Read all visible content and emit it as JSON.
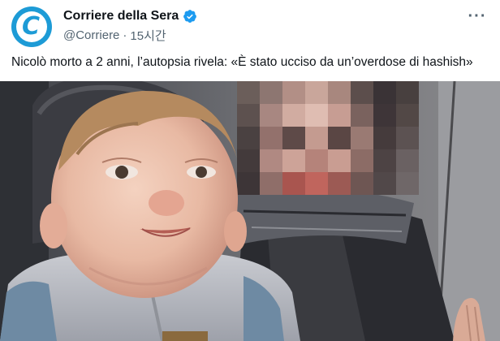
{
  "account": {
    "display_name": "Corriere della Sera",
    "handle": "@Corriere",
    "separator": "·",
    "timestamp": "15시간",
    "avatar_letter": "C",
    "avatar_color": "#1d9bd6",
    "verified_color": "#1d9bf0",
    "avatar_icon": "corriere-logo-icon",
    "verified_icon": "verified-badge-icon"
  },
  "more_menu": {
    "label": "···",
    "icon": "more-horizontal-icon"
  },
  "tweet": {
    "text": "Nicolò morto a 2 anni, l’autopsia rivela: «È stato ucciso da un’overdose di hashish»"
  },
  "media": {
    "description_icon": "photo-icon"
  }
}
